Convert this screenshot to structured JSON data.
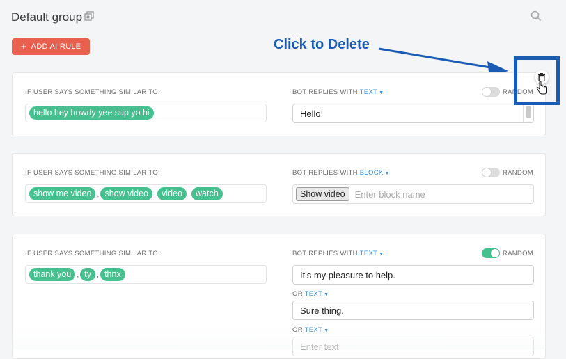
{
  "header": {
    "group_title": "Default group",
    "add_button": "ADD AI RULE"
  },
  "annotation": {
    "text": "Click to Delete"
  },
  "rules": [
    {
      "user_label": "IF USER SAYS SOMETHING SIMILAR TO:",
      "phrases": [
        "hello hey howdy yee sup yo hi"
      ],
      "bot_label": "BOT REPLIES WITH",
      "reply_type": "TEXT",
      "random_label": "RANDOM",
      "random_on": false,
      "reply": "Hello!"
    },
    {
      "user_label": "IF USER SAYS SOMETHING SIMILAR TO:",
      "phrases": [
        "show me video",
        "show video",
        "video",
        "watch"
      ],
      "bot_label": "BOT REPLIES WITH",
      "reply_type": "BLOCK",
      "random_label": "RANDOM",
      "random_on": false,
      "block": "Show video",
      "block_placeholder": "Enter block name"
    },
    {
      "user_label": "IF USER SAYS SOMETHING SIMILAR TO:",
      "phrases": [
        "thank you",
        "ty",
        "thnx"
      ],
      "bot_label": "BOT REPLIES WITH",
      "reply_type": "TEXT",
      "random_label": "RANDOM",
      "random_on": true,
      "reply": "It's my pleasure to help.",
      "or_label": "OR",
      "or_type": "TEXT",
      "reply2": "Sure thing.",
      "or_type2": "TEXT",
      "reply3_placeholder": "Enter text"
    }
  ],
  "colors": {
    "accent_red": "#e9604e",
    "chip_green": "#46c08e",
    "link_blue": "#3a8fd9",
    "annotation_blue": "#1a5bb4"
  },
  "icons": [
    "copy-icon",
    "search-icon",
    "plus-icon",
    "trash-icon",
    "hand-cursor-icon",
    "caret-down-icon"
  ]
}
